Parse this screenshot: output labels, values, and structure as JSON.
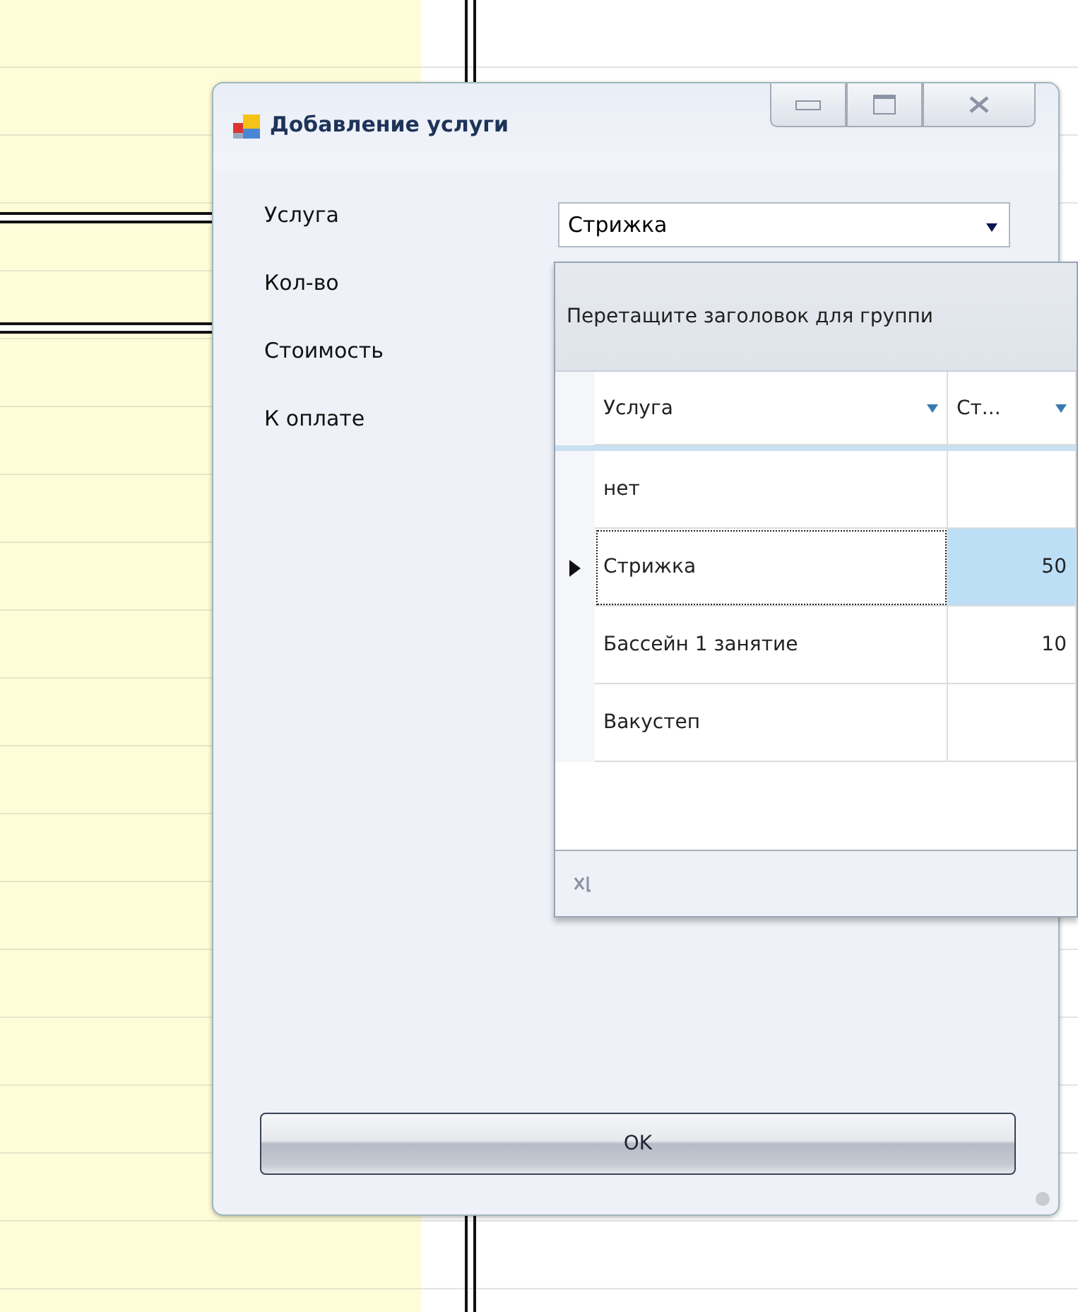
{
  "window": {
    "title": "Добавление услуги"
  },
  "labels": [
    "Услуга",
    "Кол-во",
    "Стоимость",
    "К оплате"
  ],
  "service_combo": {
    "value": "Стрижка"
  },
  "dropdown": {
    "group_panel": "Перетащите заголовок для группи",
    "columns": [
      "Услуга",
      "Ст..."
    ],
    "rows": [
      {
        "service": "нет",
        "selected": false
      },
      {
        "service": "Стрижка",
        "price": "50",
        "selected": true
      },
      {
        "service": "Бассейн 1 занятие",
        "price": "10",
        "selected": false
      },
      {
        "service": "Вакустеп",
        "selected": false
      }
    ]
  },
  "ok_button": "OK"
}
